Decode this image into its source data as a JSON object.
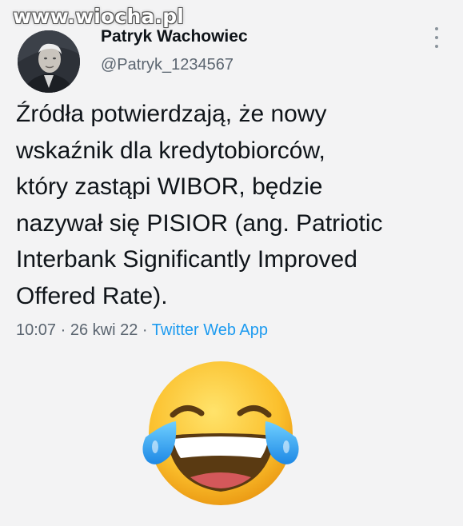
{
  "watermark": "www.wiocha.pl",
  "author": {
    "name": "Patryk Wachowiec",
    "handle": "@Patryk_1234567"
  },
  "tweet": {
    "text": "Źródła potwierdzają, że nowy\nwskaźnik dla kredytobiorców,\nktóry zastąpi WIBOR, będzie\nnazywał się PISIOR (ang. Patriotic\nInterbank Significantly Improved\nOffered Rate)."
  },
  "meta": {
    "time": "10:07",
    "sep1": " · ",
    "date": "26 kwi 22",
    "sep2": " · ",
    "app": "Twitter Web App"
  },
  "icons": {
    "more": "more-vertical-icon",
    "emoji": "face-with-tears-of-joy"
  },
  "colors": {
    "link": "#1d9bf0",
    "text": "#0f1419",
    "secondary": "#5b6570"
  }
}
